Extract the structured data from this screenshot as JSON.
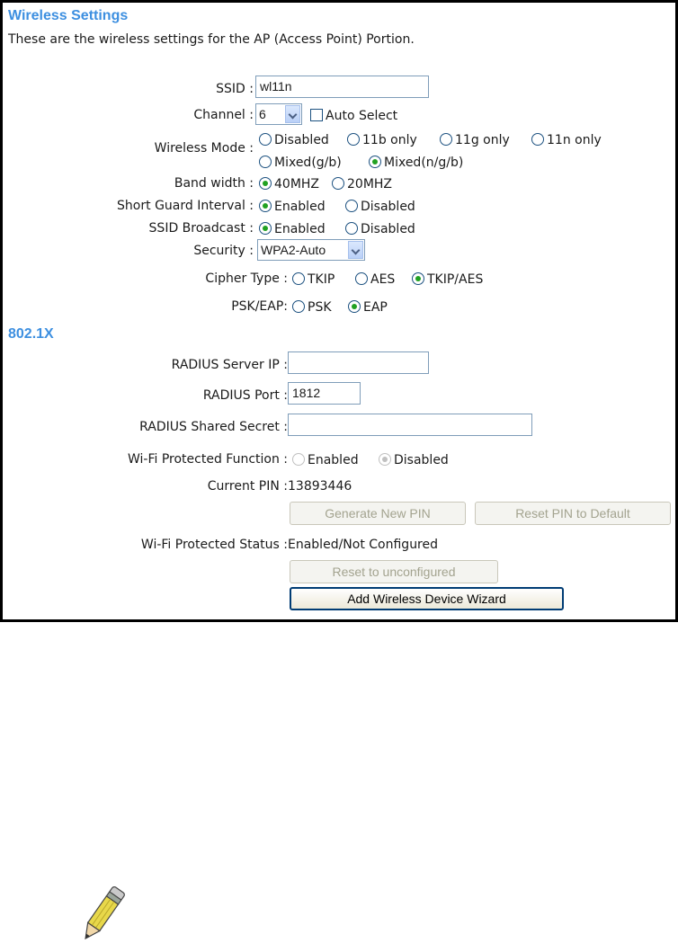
{
  "header": {
    "title": "Wireless Settings",
    "description": "These are the wireless settings for the AP (Access Point) Portion."
  },
  "form": {
    "ssid": {
      "label": "SSID :",
      "value": "wl11n"
    },
    "channel": {
      "label": "Channel :",
      "value": "6",
      "auto_select_label": "Auto Select",
      "auto_select_checked": false
    },
    "wireless_mode": {
      "label": "Wireless Mode :",
      "options": [
        "Disabled",
        "11b only",
        "11g only",
        "11n only",
        "Mixed(g/b)",
        "Mixed(n/g/b)"
      ],
      "selected": "Mixed(n/g/b)"
    },
    "band_width": {
      "label": "Band width :",
      "options": [
        "40MHZ",
        "20MHZ"
      ],
      "selected": "40MHZ"
    },
    "short_guard": {
      "label": "Short Guard Interval :",
      "options": [
        "Enabled",
        "Disabled"
      ],
      "selected": "Enabled"
    },
    "ssid_broadcast": {
      "label": "SSID Broadcast :",
      "options": [
        "Enabled",
        "Disabled"
      ],
      "selected": "Enabled"
    },
    "security": {
      "label": "Security :",
      "value": "WPA2-Auto"
    },
    "cipher_type": {
      "label": "Cipher Type :",
      "options": [
        "TKIP",
        "AES",
        "TKIP/AES"
      ],
      "selected": "TKIP/AES"
    },
    "psk_eap": {
      "label": "PSK/EAP:",
      "options": [
        "PSK",
        "EAP"
      ],
      "selected": "EAP"
    }
  },
  "radius": {
    "section_title": "802.1X",
    "server_ip": {
      "label": "RADIUS Server IP :",
      "value": ""
    },
    "port": {
      "label": "RADIUS Port :",
      "value": "1812"
    },
    "shared_secret": {
      "label": "RADIUS Shared Secret :",
      "value": ""
    }
  },
  "wps": {
    "function": {
      "label": "Wi-Fi Protected Function :",
      "options": [
        "Enabled",
        "Disabled"
      ],
      "selected": "Disabled"
    },
    "current_pin": {
      "label": "Current PIN :",
      "value": "13893446"
    },
    "generate_pin_button": "Generate New PIN",
    "reset_pin_button": "Reset PIN to Default",
    "status": {
      "label": "Wi-Fi Protected Status :",
      "value": "Enabled/Not Configured"
    },
    "reset_unconfigured_button": "Reset to unconfigured",
    "add_device_wizard_button": "Add Wireless Device Wizard"
  },
  "note_icon": "pencil-icon",
  "colors": {
    "title_blue": "#3d8fe0",
    "radio_selected": "#21a121",
    "border": "#000000"
  }
}
